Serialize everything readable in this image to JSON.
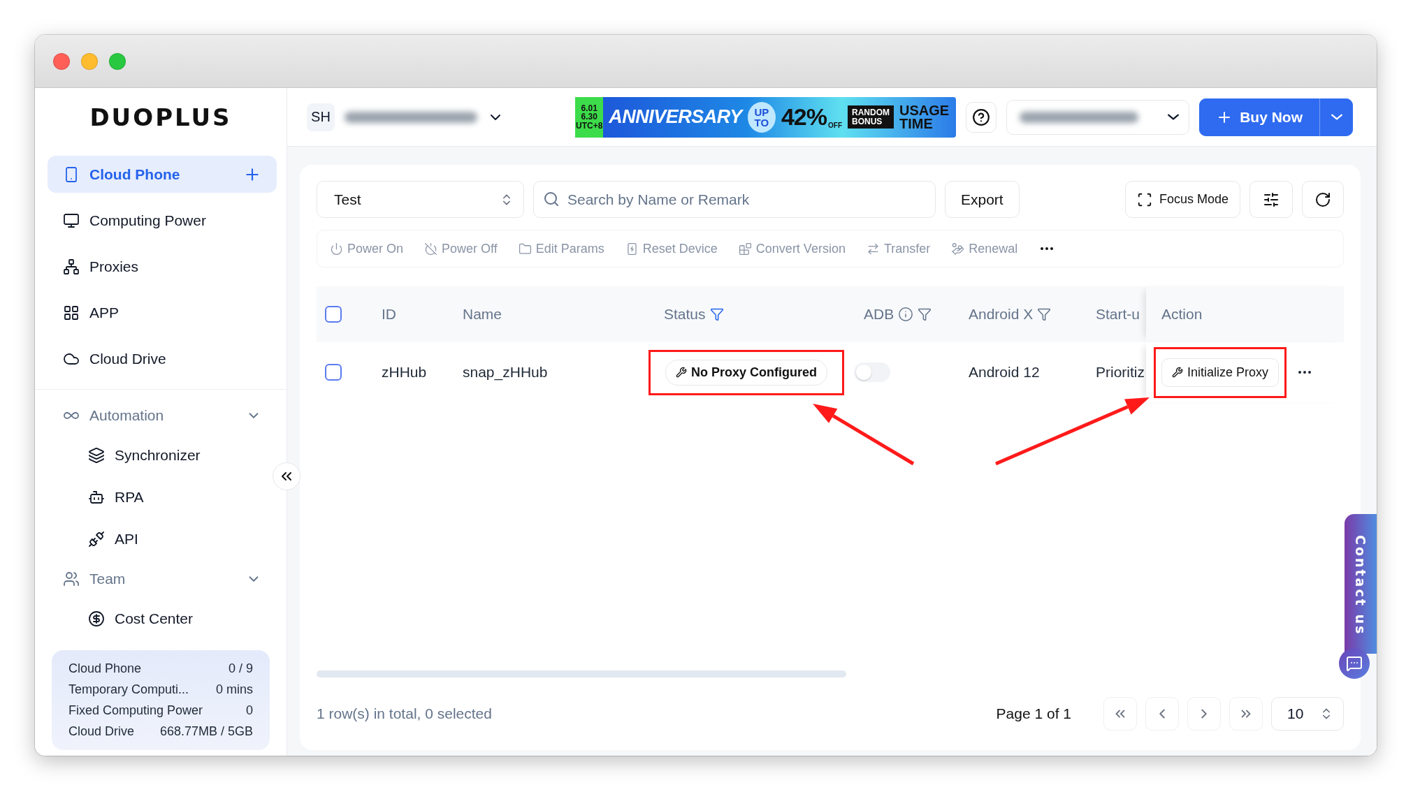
{
  "sidebar": {
    "logo": "DUOPLUS",
    "nav": [
      {
        "label": "Cloud Phone",
        "selected": true
      },
      {
        "label": "Computing Power",
        "selected": false
      },
      {
        "label": "Proxies",
        "selected": false
      },
      {
        "label": "APP",
        "selected": false
      },
      {
        "label": "Cloud Drive",
        "selected": false
      }
    ],
    "groups": [
      {
        "label": "Automation",
        "expanded": true,
        "children": [
          {
            "label": "Synchronizer"
          },
          {
            "label": "RPA"
          },
          {
            "label": "API"
          }
        ]
      },
      {
        "label": "Team",
        "expanded": true,
        "children": [
          {
            "label": "Cost Center"
          }
        ]
      }
    ],
    "usage": [
      {
        "label": "Cloud Phone",
        "value": "0 / 9"
      },
      {
        "label": "Temporary Computi...",
        "value": "0 mins"
      },
      {
        "label": "Fixed Computing Power",
        "value": "0"
      },
      {
        "label": "Cloud Drive",
        "value": "668.77MB / 5GB"
      }
    ]
  },
  "header": {
    "avatar": "SH",
    "banner": {
      "dates": [
        "6.01",
        "6.30",
        "UTC+8"
      ],
      "title": "ANNIVERSARY",
      "up_to": [
        "UP",
        "TO"
      ],
      "discount": "42%",
      "off": "OFF",
      "bonus": [
        "RANDOM",
        "BONUS"
      ],
      "usage": [
        "USAGE",
        "TIME"
      ]
    },
    "buy_button": "Buy Now"
  },
  "toolbar": {
    "group": "Test",
    "search": {
      "placeholder": "Search by Name or Remark"
    },
    "export": "Export",
    "focus_mode": "Focus Mode",
    "actions": [
      "Power On",
      "Power Off",
      "Edit Params",
      "Reset Device",
      "Convert Version",
      "Transfer",
      "Renewal"
    ]
  },
  "table": {
    "all_checked": false,
    "columns": [
      {
        "label": "ID"
      },
      {
        "label": "Name"
      },
      {
        "label": "Status",
        "filter": true,
        "filter_active": true
      },
      {
        "label": "ADB",
        "info": true,
        "filter": true,
        "filter_active": false
      },
      {
        "label": "Android X",
        "filter": true,
        "filter_active": false
      },
      {
        "label": "Start-u"
      },
      {
        "label": "Action"
      }
    ],
    "rows": [
      {
        "checked": false,
        "id": "zHHub",
        "name": "snap_zHHub",
        "status": {
          "text": "No Proxy Configured",
          "highlighted": true
        },
        "adb": false,
        "android": "Android 12",
        "start": "Prioritiz",
        "action": {
          "label": "Initialize Proxy",
          "highlighted": true
        }
      }
    ]
  },
  "footer": {
    "summary": "1 row(s) in total, 0 selected",
    "page": "Page 1 of 1",
    "page_size": "10"
  },
  "contact": {
    "label": "Contact us"
  }
}
